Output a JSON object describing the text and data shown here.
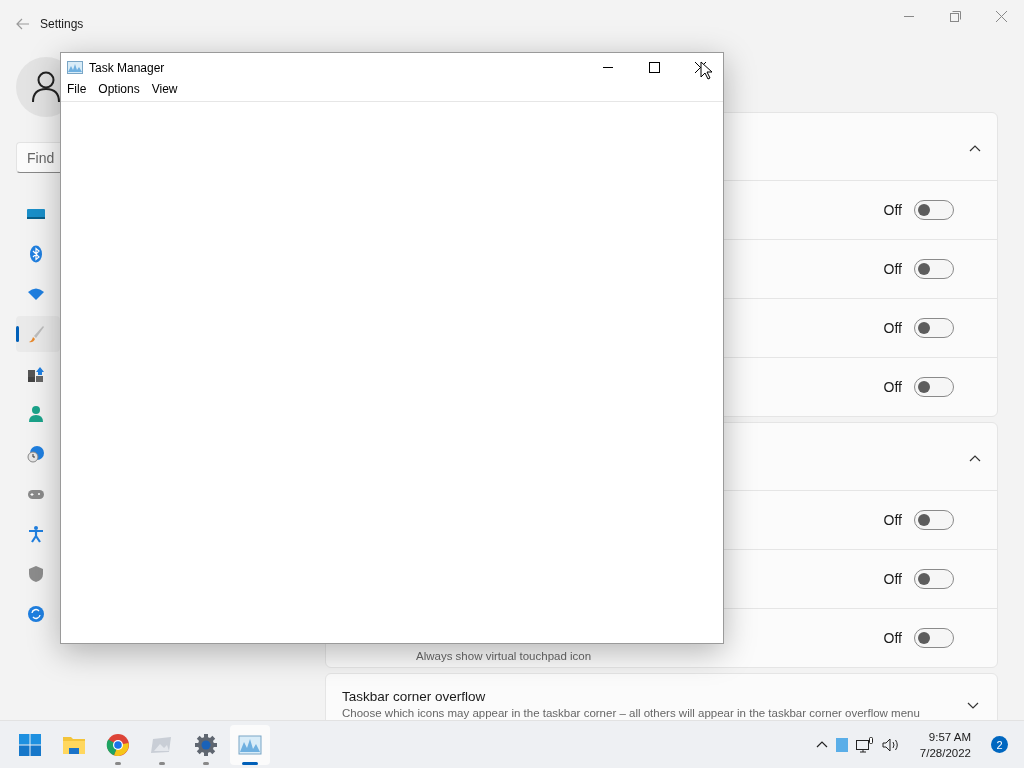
{
  "settings": {
    "title": "Settings",
    "search": {
      "placeholder": "Find"
    },
    "nav": [
      {
        "selected": false
      },
      {
        "selected": false
      },
      {
        "selected": false
      },
      {
        "selected": true
      },
      {
        "selected": false
      },
      {
        "selected": false
      },
      {
        "selected": false
      },
      {
        "selected": false
      },
      {
        "selected": false
      },
      {
        "selected": false
      },
      {
        "selected": false
      }
    ],
    "cards": [
      {
        "expanded": true,
        "rows": [
          {
            "value": "Off",
            "on": false
          },
          {
            "value": "Off",
            "on": false
          },
          {
            "value": "Off",
            "on": false
          },
          {
            "value": "Off",
            "on": false
          }
        ]
      },
      {
        "expanded": true,
        "rows": [
          {
            "value": "Off",
            "on": false
          },
          {
            "value": "Off",
            "on": false
          },
          {
            "value": "Off",
            "on": false,
            "description": "Always show virtual touchpad icon"
          }
        ]
      },
      {
        "expanded": false,
        "title": "Taskbar corner overflow",
        "description": "Choose which icons may appear in the taskbar corner – all others will appear in the taskbar corner overflow menu"
      }
    ]
  },
  "task_manager": {
    "title": "Task Manager",
    "menu": [
      "File",
      "Options",
      "View"
    ]
  },
  "taskbar": {
    "apps": [
      {
        "running": false,
        "active": false
      },
      {
        "running": false,
        "active": false
      },
      {
        "running": true,
        "active": false
      },
      {
        "running": true,
        "active": false
      },
      {
        "running": true,
        "active": false
      },
      {
        "running": true,
        "active": true
      }
    ],
    "tray": {
      "time": "9:57 AM",
      "date": "7/28/2022",
      "notifications": "2"
    }
  }
}
